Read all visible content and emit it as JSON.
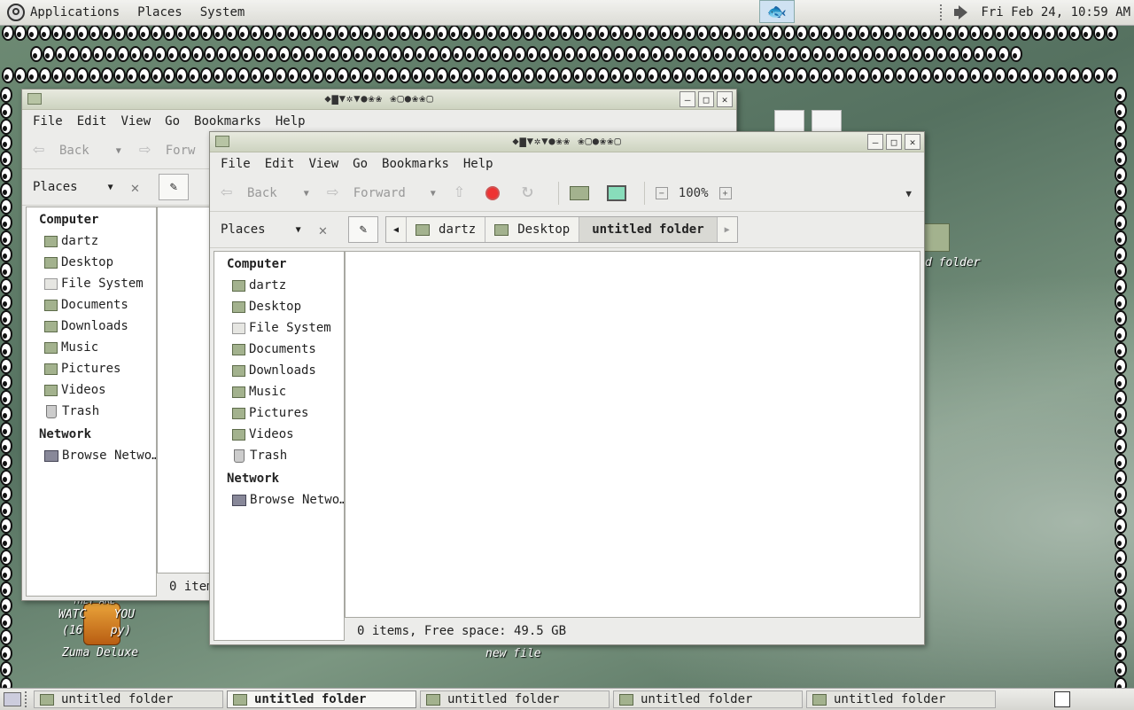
{
  "top_panel": {
    "menus": [
      "Applications",
      "Places",
      "System"
    ],
    "clock": "Fri Feb 24, 10:59 AM"
  },
  "desktop": {
    "icons": {
      "zuma_top_text": "THEY ARE",
      "zuma_line1": "WATC    YOU",
      "zuma_line2": "(16    py)",
      "zuma_label": "Zuma Deluxe",
      "new_file_label": "new file",
      "folder_label": "d folder"
    }
  },
  "back_window": {
    "title": "◆▆▼✲▼●❀❀ ❀▢●❀❀▢",
    "menu": [
      "File",
      "Edit",
      "View",
      "Go",
      "Bookmarks",
      "Help"
    ],
    "toolbar": {
      "back": "Back",
      "forward": "Forw"
    },
    "places_label": "Places",
    "sidebar": {
      "computer_heading": "Computer",
      "items": [
        "dartz",
        "Desktop",
        "File System",
        "Documents",
        "Downloads",
        "Music",
        "Pictures",
        "Videos",
        "Trash"
      ],
      "network_heading": "Network",
      "network_items": [
        "Browse Netwo…"
      ]
    },
    "status": "0 item"
  },
  "front_window": {
    "title": "◆▆▼✲▼●❀❀ ❀▢●❀❀▢",
    "menu": [
      "File",
      "Edit",
      "View",
      "Go",
      "Bookmarks",
      "Help"
    ],
    "toolbar": {
      "back": "Back",
      "forward": "Forward",
      "zoom": "100%"
    },
    "places_label": "Places",
    "breadcrumbs": [
      "dartz",
      "Desktop",
      "untitled folder"
    ],
    "sidebar": {
      "computer_heading": "Computer",
      "items": [
        "dartz",
        "Desktop",
        "File System",
        "Documents",
        "Downloads",
        "Music",
        "Pictures",
        "Videos",
        "Trash"
      ],
      "network_heading": "Network",
      "network_items": [
        "Browse Netwo…"
      ]
    },
    "status": "0 items, Free space: 49.5 GB"
  },
  "taskbar": {
    "tasks": [
      {
        "label": "untitled folder",
        "active": false
      },
      {
        "label": "untitled folder",
        "active": true
      },
      {
        "label": "untitled folder",
        "active": false
      },
      {
        "label": "untitled folder",
        "active": false
      },
      {
        "label": "untitled folder",
        "active": false
      }
    ]
  },
  "colors": {
    "desktop": "#5f8067",
    "folder": "#a3b28e",
    "stop": "#ee3333"
  }
}
